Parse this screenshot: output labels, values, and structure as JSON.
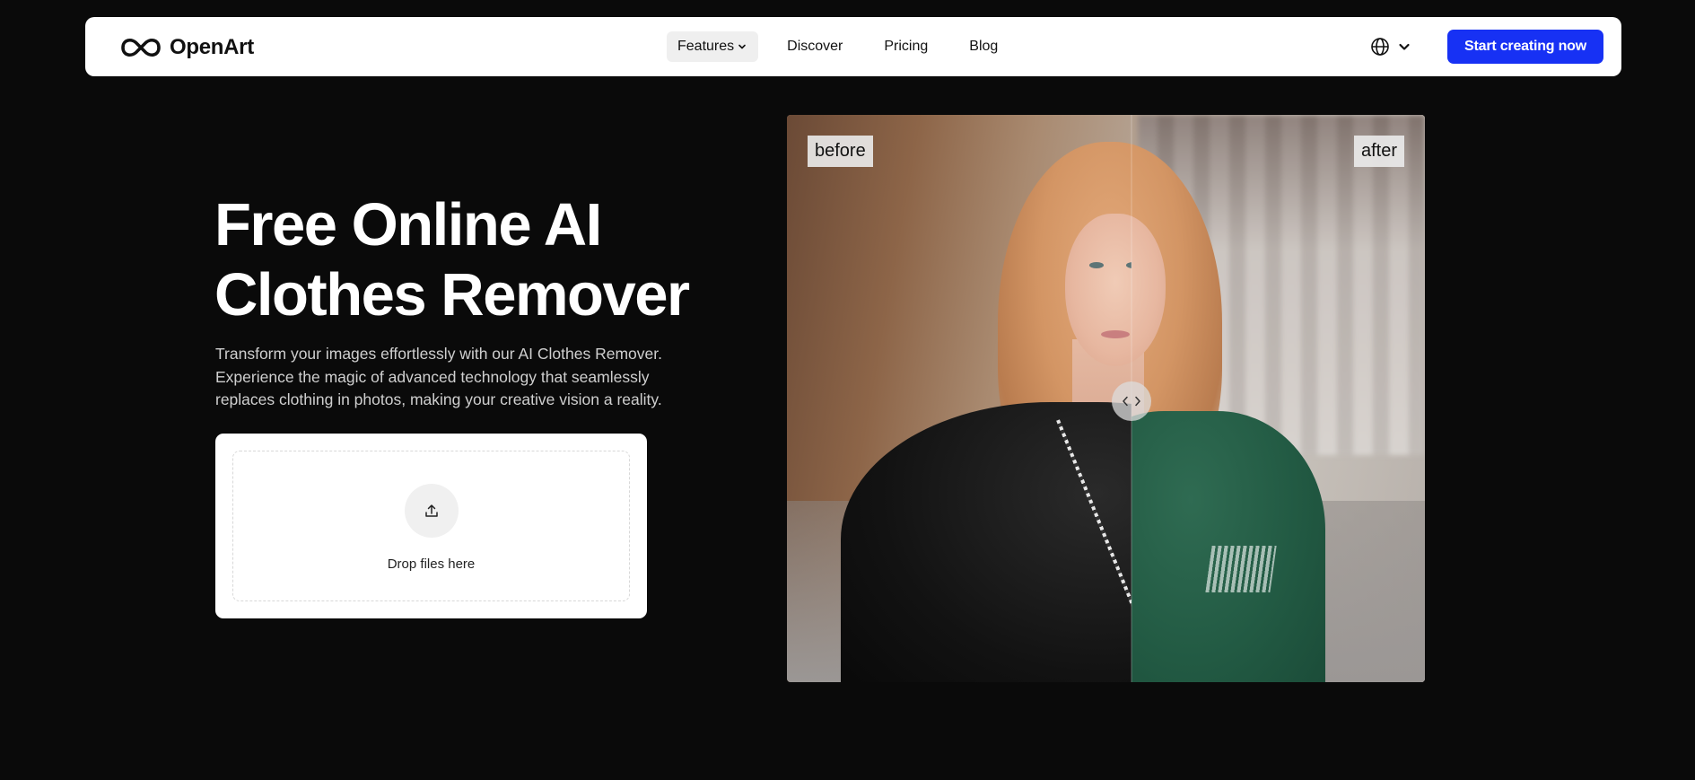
{
  "brand": {
    "name": "OpenArt"
  },
  "nav": {
    "links": [
      {
        "label": "Features",
        "active": true,
        "has_dropdown": true
      },
      {
        "label": "Discover"
      },
      {
        "label": "Pricing"
      },
      {
        "label": "Blog"
      }
    ],
    "language_icon": "globe-icon",
    "cta_label": "Start creating now"
  },
  "hero": {
    "title_line1": "Free Online AI",
    "title_line2": "Clothes Remover",
    "description_line1": "Transform your images effortlessly with our AI Clothes Remover.",
    "description_line2": "Experience the magic of advanced technology that seamlessly",
    "description_line3": "replaces clothing in photos, making your creative vision a reality."
  },
  "upload": {
    "icon": "upload-icon",
    "label": "Drop files here"
  },
  "compare": {
    "before_label": "before",
    "after_label": "after",
    "handle_icon": "chevron-left-right-icon"
  },
  "colors": {
    "background": "#0a0a0a",
    "accent": "#1731f4",
    "nav_bg": "#ffffff"
  }
}
